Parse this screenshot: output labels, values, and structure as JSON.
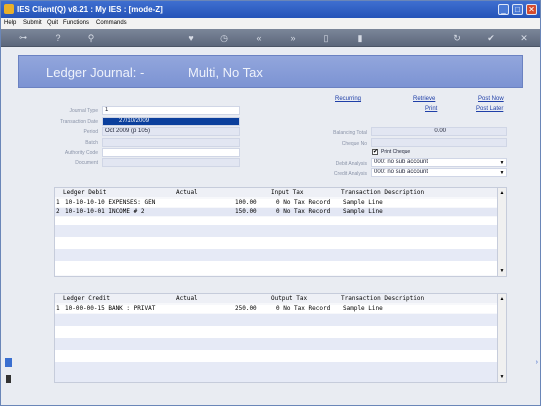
{
  "window": {
    "title": "IES Client(Q) v8.21 : My IES :      [mode-Z]",
    "minimize": "_",
    "maximize": "□",
    "close": "✕"
  },
  "menu": [
    "Help",
    "Submit",
    "Quit",
    "Functions",
    "Commands"
  ],
  "toolbar": {
    "help_glyph": "?",
    "search_glyph": "⚲",
    "icons": [
      "key-icon",
      "help-icon",
      "search-icon",
      "heart-icon",
      "clock-icon",
      "rewind-icon",
      "fast-forward-icon",
      "document-icon",
      "trash-icon",
      "refresh-icon",
      "check-icon",
      "close-icon"
    ],
    "key_glyph": "⊶",
    "heart_glyph": "♥",
    "clock_glyph": "◷",
    "rewind_glyph": "«",
    "ff_glyph": "»",
    "doc_glyph": "▯",
    "trash_glyph": "▮",
    "refresh_glyph": "↻",
    "check_glyph": "✔",
    "close_glyph": "✕"
  },
  "header": {
    "title": "Ledger Journal: -",
    "subtitle": "Multi, No Tax"
  },
  "links": {
    "recurring": "Recurring",
    "retrieve": "Retrieve",
    "print": "Print",
    "post_now": "Post Now",
    "post_later": "Post Later"
  },
  "form_left": {
    "journal_type_label": "Journal Type",
    "journal_type": "1",
    "transaction_date_label": "Transaction Date",
    "transaction_date": "27/10/2009",
    "period_label": "Period",
    "period": "Oct 2009 (p 105)",
    "batch_label": "Batch",
    "batch": "",
    "authority_code_label": "Authority Code",
    "authority_code": "",
    "document_label": "Document",
    "document": ""
  },
  "form_right": {
    "balancing_total_label": "Balancing Total",
    "balancing_total": "0.00",
    "cheque_no_label": "Cheque No",
    "cheque_no": "",
    "print_cheque_label": "Print Cheque",
    "print_cheque_checked": "✔",
    "debit_analysis_label": "Debit Analysis",
    "debit_analysis": "000: no sub account",
    "credit_analysis_label": "Credit Analysis",
    "credit_analysis": "000: no sub account"
  },
  "debit_grid": {
    "headers": {
      "ledger": "Ledger Debit",
      "actual": "Actual",
      "tax": "Input Tax",
      "desc": "Transaction Description"
    },
    "rows": [
      {
        "n": "1",
        "ledger": "10-10-10-10 EXPENSES: GEN",
        "actual": "100.00",
        "tax": "0 No Tax Record",
        "desc": "Sample Line"
      },
      {
        "n": "2",
        "ledger": "10-10-10-01 INCOME # 2",
        "actual": "150.00",
        "tax": "0 No Tax Record",
        "desc": "Sample Line"
      }
    ]
  },
  "credit_grid": {
    "headers": {
      "ledger": "Ledger Credit",
      "actual": "Actual",
      "tax": "Output Tax",
      "desc": "Transaction Description"
    },
    "rows": [
      {
        "n": "1",
        "ledger": "10-00-00-15 BANK : PRIVAT",
        "actual": "250.00",
        "tax": "0 No Tax Record",
        "desc": "Sample Line"
      }
    ]
  },
  "colors": {
    "title_bar": "#2f5fc4",
    "header_band": "#8297d6",
    "selected_field": "#0b3f9c",
    "link": "#1f3fa8"
  }
}
